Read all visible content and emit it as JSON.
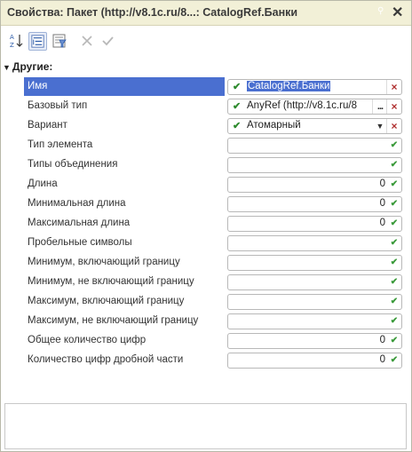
{
  "window": {
    "title": "Свойства: Пакет (http://v8.1c.ru/8...: CatalogRef.Банки",
    "pin_glyph": "⚲",
    "close_glyph": "✕"
  },
  "toolbar": {
    "icons": [
      "sort-alphabetical-icon",
      "categorize-icon",
      "filter-icon",
      "clear-icon",
      "confirm-icon"
    ]
  },
  "group": {
    "label": "Другие:"
  },
  "rows": [
    {
      "label": "Имя",
      "check": "✔",
      "value": "CatalogRef.Банки",
      "buttons": [
        "×"
      ]
    },
    {
      "label": "Базовый тип",
      "check": "✔",
      "value": "AnyRef (http://v8.1c.ru/8",
      "buttons": [
        "...",
        "×"
      ]
    },
    {
      "label": "Вариант",
      "check": "✔",
      "value": "Атомарный",
      "buttons": [
        "▼",
        "×"
      ]
    },
    {
      "label": "Тип элемента",
      "buttons": [
        "✔"
      ]
    },
    {
      "label": "Типы объединения",
      "buttons": [
        "✔"
      ]
    },
    {
      "label": "Длина",
      "number": "0",
      "buttons": [
        "✔"
      ]
    },
    {
      "label": "Минимальная длина",
      "number": "0",
      "buttons": [
        "✔"
      ]
    },
    {
      "label": "Максимальная длина",
      "number": "0",
      "buttons": [
        "✔"
      ]
    },
    {
      "label": "Пробельные символы",
      "buttons": [
        "✔"
      ]
    },
    {
      "label": "Минимум, включающий границу",
      "buttons": [
        "✔"
      ]
    },
    {
      "label": "Минимум, не включающий границу",
      "buttons": [
        "✔"
      ]
    },
    {
      "label": "Максимум, включающий границу",
      "buttons": [
        "✔"
      ]
    },
    {
      "label": "Максимум, не включающий границу",
      "buttons": [
        "✔"
      ]
    },
    {
      "label": "Общее количество цифр",
      "number": "0",
      "buttons": [
        "✔"
      ]
    },
    {
      "label": "Количество цифр дробной части",
      "number": "0",
      "buttons": [
        "✔"
      ]
    }
  ],
  "colors": {
    "title_bg": "#f2f0d7",
    "selection": "#4a6fd0",
    "check_green": "#3a9a3a",
    "clear_red": "#b03030"
  }
}
